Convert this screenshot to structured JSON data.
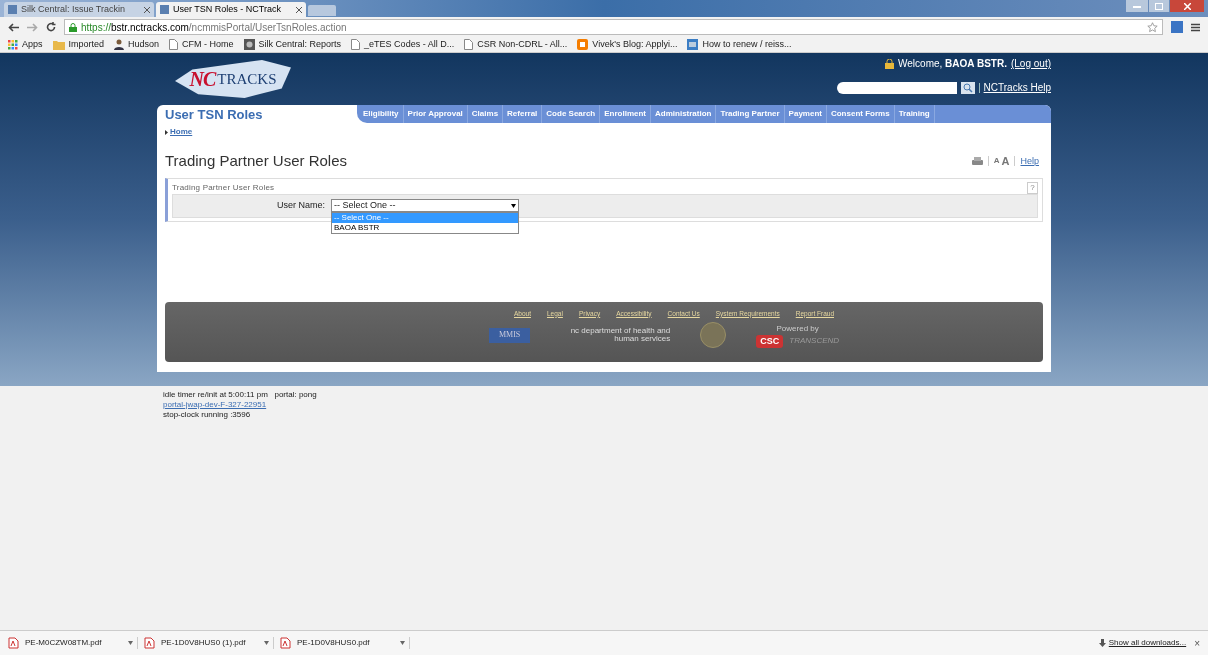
{
  "browser": {
    "tabs": [
      {
        "label": "Silk Central: Issue Trackin",
        "selected": false
      },
      {
        "label": "User TSN Roles - NCTrack",
        "selected": true
      }
    ],
    "address": {
      "scheme": "https://",
      "host": "bstr.nctracks.com",
      "path": "/ncmmisPortal/UserTsnRoles.action"
    },
    "bookmarks": [
      {
        "label": "Apps",
        "kind": "apps"
      },
      {
        "label": "Imported",
        "kind": "folder"
      },
      {
        "label": "Hudson",
        "kind": "person"
      },
      {
        "label": "CFM - Home",
        "kind": "page"
      },
      {
        "label": "Silk Central: Reports",
        "kind": "silk"
      },
      {
        "label": "_eTES Codes - All D...",
        "kind": "page"
      },
      {
        "label": "CSR Non-CDRL - All...",
        "kind": "page"
      },
      {
        "label": "Vivek's Blog: Applyi...",
        "kind": "blog"
      },
      {
        "label": "How to renew / reiss...",
        "kind": "web"
      }
    ]
  },
  "header": {
    "logo": {
      "mark": "NC",
      "word": "TRACKS"
    },
    "welcome": "Welcome,",
    "user": "BAOA BSTR.",
    "logout": "(Log out)",
    "help_link": "NCTracks Help"
  },
  "page_tab": "User TSN Roles",
  "nav": [
    "Eligibility",
    "Prior Approval",
    "Claims",
    "Referral",
    "Code Search",
    "Enrollment",
    "Administration",
    "Trading Partner",
    "Payment",
    "Consent Forms",
    "Training"
  ],
  "breadcrumb": "Home",
  "title": "Trading Partner User Roles",
  "tools": {
    "font_small": "A",
    "font_large": "A",
    "help": "Help"
  },
  "section": {
    "legend": "Trading Partner User Roles",
    "hint": "?",
    "field_label": "User Name:",
    "value": "-- Select One --",
    "options": [
      {
        "label": "-- Select One --",
        "selected": true
      },
      {
        "label": "BAOA BSTR",
        "selected": false
      }
    ]
  },
  "footer": {
    "links": [
      "About",
      "Legal",
      "Privacy",
      "Accessibility",
      "Contact Us",
      "System Requirements",
      "Report Fraud"
    ],
    "mmis": "MMIS",
    "dhhs": "nc department of health and human services",
    "powered": "Powered by",
    "csc": "CSC",
    "transcend": "TRANSCEND"
  },
  "debug": {
    "line1": "idle timer re/init at 5:00:11 pm   portal: pong",
    "link": "portal-jwap-dev-F-327-22951",
    "line3": "stop-clock running :3596"
  },
  "downloads": {
    "files": [
      "PE-M0CZW08TM.pdf",
      "PE-1D0V8HUS0 (1).pdf",
      "PE-1D0V8HUS0.pdf"
    ],
    "show_all": "Show all downloads...",
    "close": "×"
  }
}
